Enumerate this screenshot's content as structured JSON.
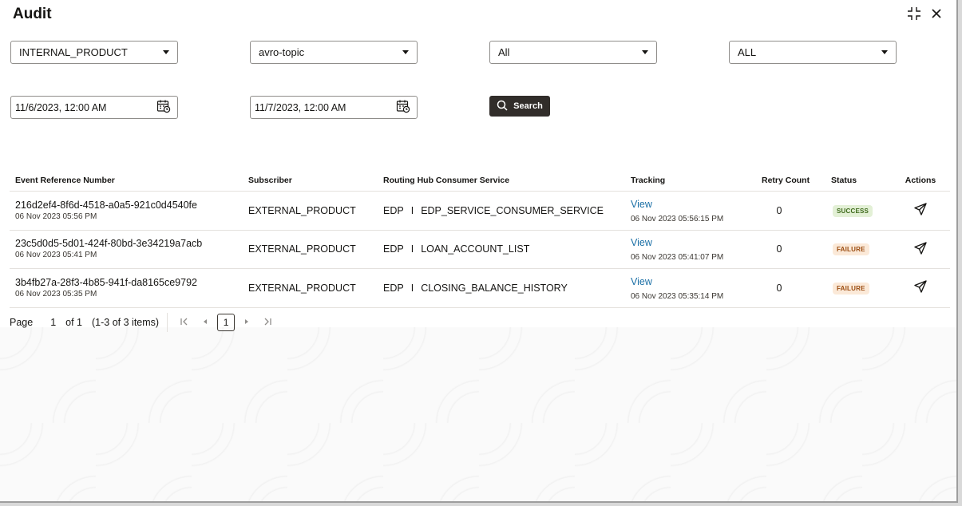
{
  "window": {
    "title": "Audit"
  },
  "filters": {
    "selects": [
      {
        "value": "INTERNAL_PRODUCT"
      },
      {
        "value": "avro-topic"
      },
      {
        "value": "All"
      },
      {
        "value": "ALL"
      }
    ],
    "from_date": "11/6/2023, 12:00 AM",
    "to_date": "11/7/2023, 12:00 AM",
    "search_label": "Search"
  },
  "table": {
    "headers": {
      "ref": "Event Reference Number",
      "subscriber": "Subscriber",
      "service": "Routing Hub Consumer Service",
      "tracking": "Tracking",
      "retry": "Retry Count",
      "status": "Status",
      "actions": "Actions"
    },
    "rows": [
      {
        "ref": "216d2ef4-8f6d-4518-a0a5-921c0d4540fe",
        "ref_time": "06 Nov 2023 05:56 PM",
        "subscriber": "EXTERNAL_PRODUCT",
        "service_prefix": "EDP",
        "service_sep": "I",
        "service_name": "EDP_SERVICE_CONSUMER_SERVICE",
        "tracking_link": "View",
        "tracking_time": "06 Nov 2023 05:56:15 PM",
        "retry": "0",
        "status": "SUCCESS"
      },
      {
        "ref": "23c5d0d5-5d01-424f-80bd-3e34219a7acb",
        "ref_time": "06 Nov 2023 05:41 PM",
        "subscriber": "EXTERNAL_PRODUCT",
        "service_prefix": "EDP",
        "service_sep": "I",
        "service_name": "LOAN_ACCOUNT_LIST",
        "tracking_link": "View",
        "tracking_time": "06 Nov 2023 05:41:07 PM",
        "retry": "0",
        "status": "FAILURE"
      },
      {
        "ref": "3b4fb27a-28f3-4b85-941f-da8165ce9792",
        "ref_time": "06 Nov 2023 05:35 PM",
        "subscriber": "EXTERNAL_PRODUCT",
        "service_prefix": "EDP",
        "service_sep": "I",
        "service_name": "CLOSING_BALANCE_HISTORY",
        "tracking_link": "View",
        "tracking_time": "06 Nov 2023 05:35:14 PM",
        "retry": "0",
        "status": "FAILURE"
      }
    ]
  },
  "pagination": {
    "page_label": "Page",
    "page_value": "1",
    "of_label": "of 1",
    "items_label": "(1-3 of 3 items)",
    "current_page": "1"
  },
  "icons": {
    "collapse": "collapse-icon",
    "close": "close-icon",
    "calendar": "calendar-icon",
    "search": "search-icon",
    "send": "send-icon",
    "first": "first-page-icon",
    "prev": "prev-page-icon",
    "next": "next-page-icon",
    "last": "last-page-icon"
  },
  "colors": {
    "search_button": "#312d2a",
    "link": "#1a6fa6",
    "success_bg": "#e3f0d6",
    "success_fg": "#3f6b1c",
    "failure_bg": "#fbe9d8",
    "failure_fg": "#9b4c10"
  }
}
